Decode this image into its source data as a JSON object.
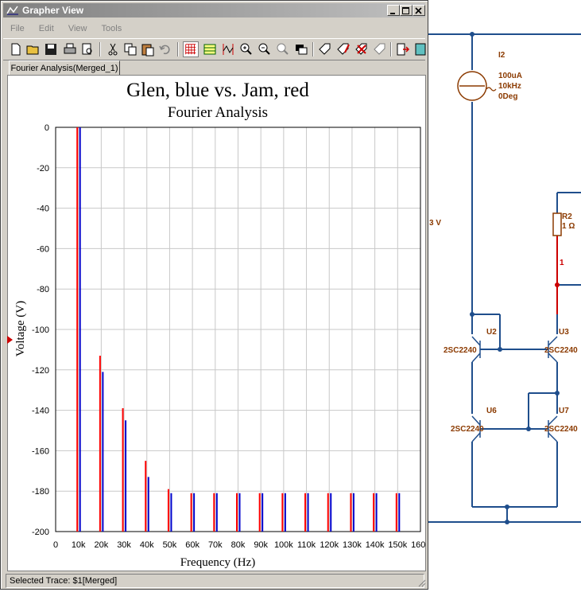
{
  "window": {
    "title": "Grapher View",
    "menu": [
      "File",
      "Edit",
      "View",
      "Tools"
    ],
    "tab_label": "Fourier Analysis(Merged_1)",
    "status": "Selected Trace:  $1[Merged]",
    "toolbar_icons": [
      "new-icon",
      "open-icon",
      "save-icon",
      "print-icon",
      "print-preview-icon",
      "cut-icon",
      "copy-icon",
      "paste-icon",
      "undo-icon",
      "grid-major-icon",
      "grid-minor-icon",
      "cursor-icon",
      "zoom-in-icon",
      "zoom-out-icon",
      "zoom-fit-icon",
      "zoom-window-icon",
      "tag-icon",
      "tag-edit-icon",
      "tag-delete-icon",
      "tag-clear-icon",
      "export-icon",
      "options-icon"
    ]
  },
  "chart_data": {
    "type": "bar",
    "title": "Glen, blue vs. Jam, red",
    "subtitle": "Fourier Analysis",
    "xlabel": "Frequency (Hz)",
    "ylabel": "Voltage (V)",
    "xlim": [
      0,
      160000
    ],
    "ylim": [
      -200,
      0
    ],
    "x_ticks": [
      "0",
      "10k",
      "20k",
      "30k",
      "40k",
      "50k",
      "60k",
      "70k",
      "80k",
      "90k",
      "100k",
      "110k",
      "120k",
      "130k",
      "140k",
      "150k",
      "160k"
    ],
    "y_ticks": [
      "0",
      "-20",
      "-40",
      "-60",
      "-80",
      "-100",
      "-120",
      "-140",
      "-160",
      "-180",
      "-200"
    ],
    "grid": true,
    "x": [
      10000,
      20000,
      30000,
      40000,
      50000,
      60000,
      70000,
      80000,
      90000,
      100000,
      110000,
      120000,
      130000,
      140000,
      150000
    ],
    "series": [
      {
        "color": "#ff0000",
        "values": [
          0,
          -113,
          -139,
          -165,
          -179,
          -181,
          -181,
          -181,
          -181,
          -181,
          -181,
          -181,
          -181,
          -181,
          -181
        ]
      },
      {
        "color": "#0000cc",
        "values": [
          0,
          -121,
          -145,
          -173,
          -181,
          -181,
          -181,
          -181,
          -181,
          -181,
          -181,
          -181,
          -181,
          -181,
          -181
        ]
      }
    ]
  },
  "schematic": {
    "source": {
      "name": "I2",
      "value": "100uA",
      "freq": "10kHz",
      "phase": "0Deg"
    },
    "resistor": {
      "name": "R2",
      "value": "1 Ω"
    },
    "node_label": "1",
    "partial_label": "3 V",
    "transistors": [
      {
        "name": "U2",
        "part": "2SC2240"
      },
      {
        "name": "U3",
        "part": "2SC2240"
      },
      {
        "name": "U6",
        "part": "2SC2240"
      },
      {
        "name": "U7",
        "part": "2SC2240"
      }
    ]
  },
  "colors": {
    "wire": "#1f4e8c",
    "label": "#8b3a00",
    "node_wire": "#cc0000"
  }
}
